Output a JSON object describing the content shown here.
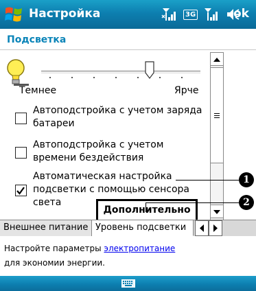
{
  "titlebar": {
    "title": "Настройка",
    "badge_3g": "3G",
    "ok_label": "ok",
    "icons": [
      "windows-start-icon",
      "signal-x-icon",
      "3g-icon",
      "signal-icon",
      "speaker-icon"
    ]
  },
  "section": {
    "title": "Подсветка"
  },
  "brightness": {
    "dark_label": "Темнее",
    "bright_label": "Ярче",
    "level": 0.68,
    "icon": "lightbulb-icon"
  },
  "options": [
    {
      "label": "Автоподстройка с учетом заряда батареи",
      "checked": false
    },
    {
      "label": "Автоподстройка с учетом времени бездействия",
      "checked": false
    },
    {
      "label": "Автоматическая настройка подсветки с помощью сенсора света",
      "checked": true
    }
  ],
  "peek_button": {
    "label": "Дополнительно"
  },
  "tabs": [
    {
      "label": "Внешнее питание",
      "active": false
    },
    {
      "label": "Уровень подсветки",
      "active": true
    }
  ],
  "note": {
    "text_before": "Настройте параметры ",
    "link": "электропитание",
    "text_after": "для экономии энергии."
  },
  "callouts": [
    "1",
    "2"
  ],
  "colors": {
    "titlebar": "#0d7fb0",
    "section_title": "#0a84b8",
    "link": "#0000ee"
  }
}
